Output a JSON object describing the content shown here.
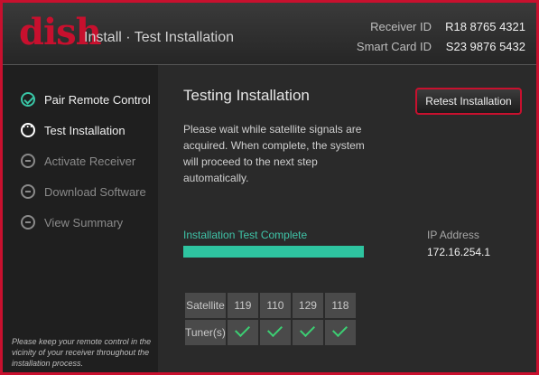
{
  "header": {
    "logo_text": "dish",
    "title": "Install · Test Installation",
    "receiver_id_label": "Receiver ID",
    "receiver_id_value": "R18 8765 4321",
    "smart_card_label": "Smart Card ID",
    "smart_card_value": "S23 9876 5432"
  },
  "sidebar": {
    "steps": [
      {
        "label": "Pair Remote Control",
        "state": "done",
        "icon": "check-circle-icon"
      },
      {
        "label": "Test Installation",
        "state": "active",
        "icon": "ellipsis-circle-icon"
      },
      {
        "label": "Activate Receiver",
        "state": "pending",
        "icon": "minus-circle-icon"
      },
      {
        "label": "Download Software",
        "state": "pending",
        "icon": "minus-circle-icon"
      },
      {
        "label": "View Summary",
        "state": "pending",
        "icon": "minus-circle-icon"
      }
    ],
    "note": "Please keep your remote control in the vicinity of your receiver throughout the installation process."
  },
  "main": {
    "title": "Testing Installation",
    "description": "Please wait while satellite signals are acquired.  When complete, the system will proceed to the next step automatically.",
    "retest_label": "Retest Installation",
    "progress_label": "Installation Test Complete",
    "progress_fraction": 1.0,
    "ip_label": "IP Address",
    "ip_value": "172.16.254.1",
    "table": {
      "row1_header": "Satellite",
      "satellites": [
        "119",
        "110",
        "129",
        "118"
      ],
      "row2_header": "Tuner(s)",
      "tuner_status": [
        "check-icon",
        "check-icon",
        "check-icon",
        "check-icon"
      ]
    }
  },
  "colors": {
    "brand": "#c8102e",
    "accent": "#2ec4a0",
    "check": "#3ccf73"
  }
}
